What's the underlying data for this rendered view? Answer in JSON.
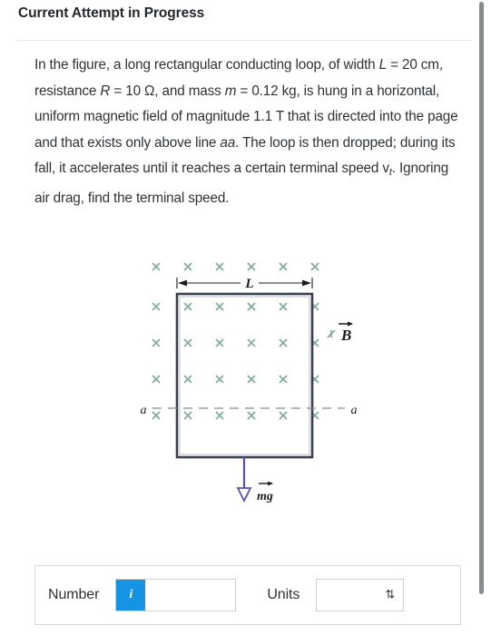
{
  "header": {
    "title": "Current Attempt in Progress"
  },
  "problem": {
    "line1_a": "In the figure, a long rectangular conducting loop, of width ",
    "var_L": "L",
    "line1_b": " = 20 cm, resistance ",
    "var_R": "R",
    "line1_c": " = 10 Ω, and mass ",
    "var_m": "m",
    "line1_d": " = 0.12 kg, is hung in a horizontal, uniform magnetic field of magnitude 1.1 T that is directed into the page and that exists only above line ",
    "var_aa": "aa",
    "line1_e": ". The loop is then dropped; during its fall, it accelerates until it reaches a certain terminal speed v",
    "sub_t": "t",
    "line1_f": ". Ignoring air drag, find the terminal speed.",
    "values": {
      "width_L": "20 cm",
      "resistance_R": "10 Ω",
      "mass_m": "0.12 kg",
      "magnetic_field_B": "1.1 T",
      "unknown": "terminal speed v_t"
    }
  },
  "figure": {
    "name": "rectangular-conducting-loop-in-magnetic-field",
    "width_label": "L",
    "field_label": "B",
    "weight_label": "mg",
    "line_label_left": "a",
    "line_label_right": "a",
    "field_mark": "×",
    "field_mark_rows": 5,
    "field_mark_cols": 6,
    "colors": {
      "field_mark": "#7fab9e",
      "loop_outline": "#3a3f52",
      "weight_arrow": "#5b52a8",
      "dash_line": "#8a8a8a"
    }
  },
  "answer": {
    "number_label": "Number",
    "units_label": "Units",
    "info_glyph": "i",
    "number_value": "",
    "number_placeholder": "",
    "units_value": "",
    "chevron_glyph": "⇅"
  }
}
